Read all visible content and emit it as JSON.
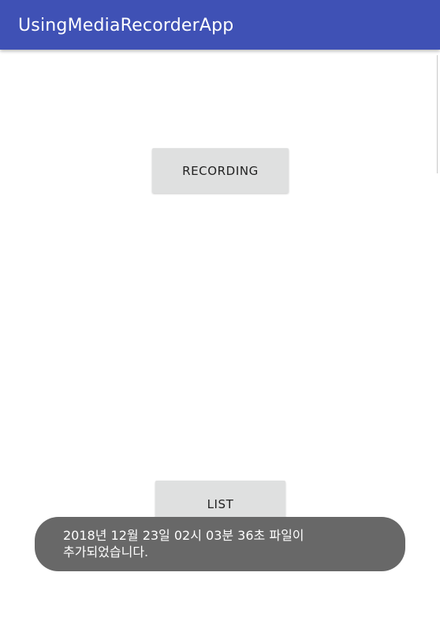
{
  "app_bar": {
    "title": "UsingMediaRecorderApp",
    "color": "#3f51b5"
  },
  "buttons": {
    "recording_label": "RECORDING",
    "list_label": "LIST",
    "background": "#dfe0e0"
  },
  "toast": {
    "message": "2018년 12월 23일 02시 03분 36초 파일이\n추가되었습니다.",
    "background": "#686868"
  }
}
